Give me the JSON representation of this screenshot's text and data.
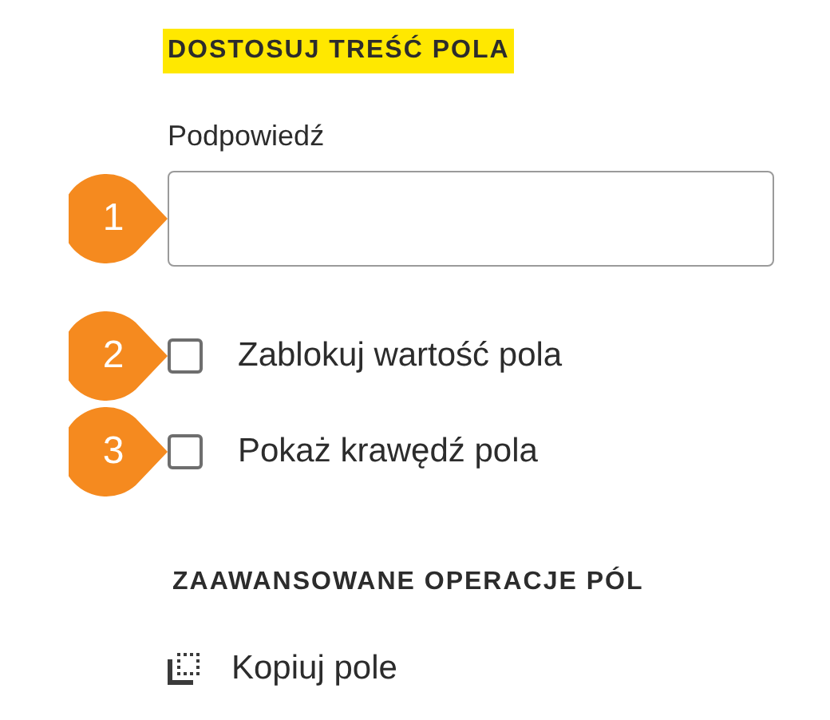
{
  "sections": [
    {
      "heading": "DOSTOSUJ TREŚĆ POLA",
      "highlighted": true,
      "items": [
        {
          "kind": "field",
          "label": "Podpowiedź",
          "callout": "1"
        },
        {
          "kind": "checkbox",
          "label": "Zablokuj wartość pola",
          "checked": false,
          "callout": "2"
        },
        {
          "kind": "checkbox",
          "label": "Pokaż krawędź pola",
          "checked": false,
          "callout": "3"
        }
      ]
    },
    {
      "heading": "ZAAWANSOWANE OPERACJE PÓL",
      "highlighted": false,
      "items": [
        {
          "kind": "action",
          "label": "Kopiuj pole"
        }
      ]
    }
  ]
}
